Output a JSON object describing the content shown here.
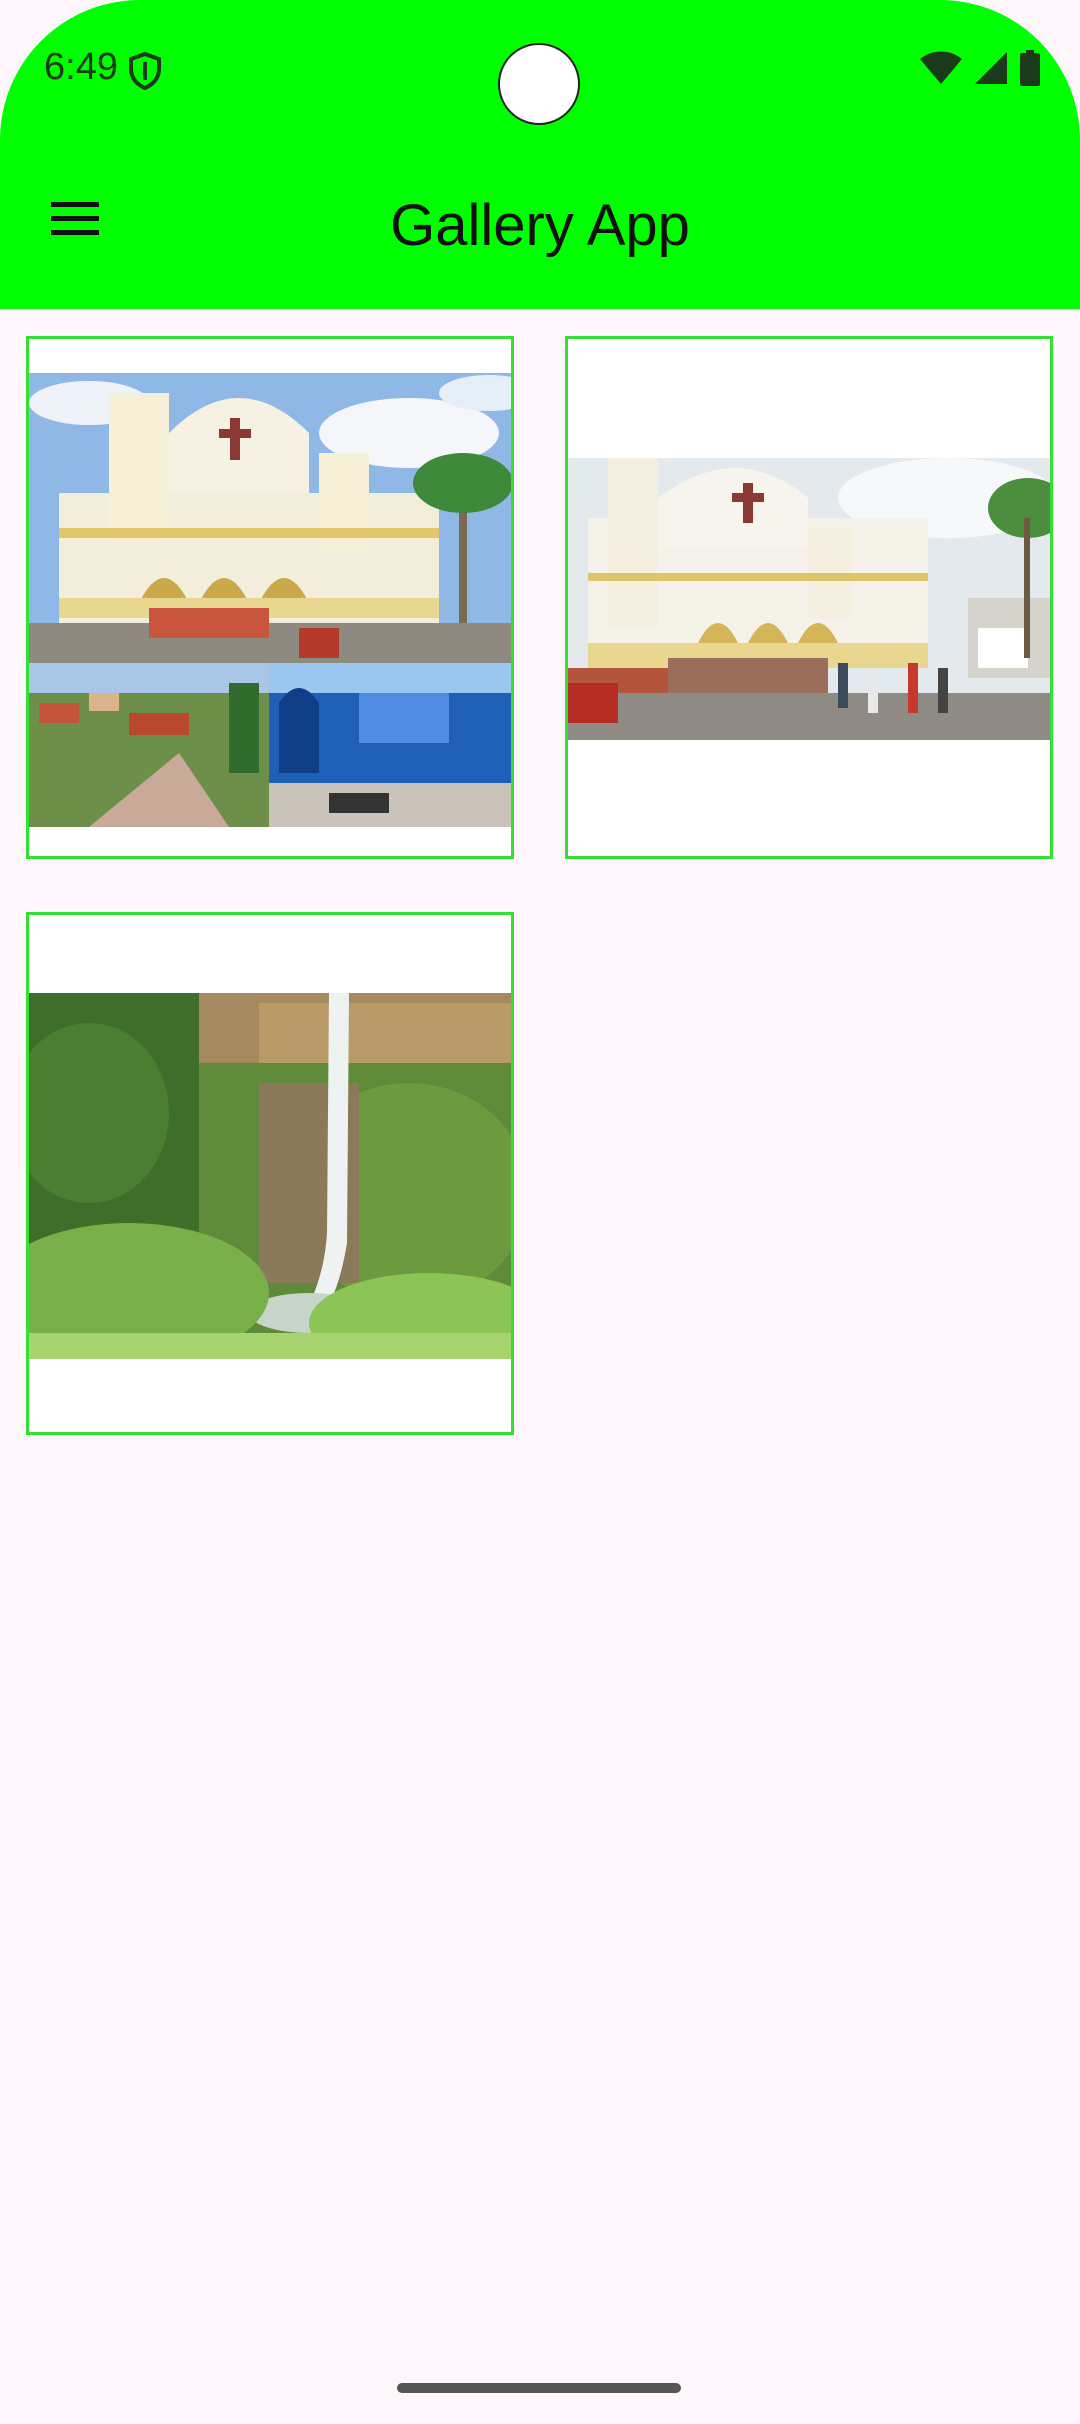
{
  "status_bar": {
    "time": "6:49",
    "icons": [
      "shield-icon",
      "wifi-icon",
      "signal-icon",
      "battery-icon"
    ]
  },
  "app_bar": {
    "title": "Gallery App",
    "menu_icon": "menu-icon",
    "color": "#00ff00"
  },
  "gallery": {
    "border_color": "#33e033",
    "items": [
      {
        "image": "church-collage-photo"
      },
      {
        "image": "church-street-photo"
      },
      {
        "image": "waterfall-photo"
      }
    ]
  }
}
